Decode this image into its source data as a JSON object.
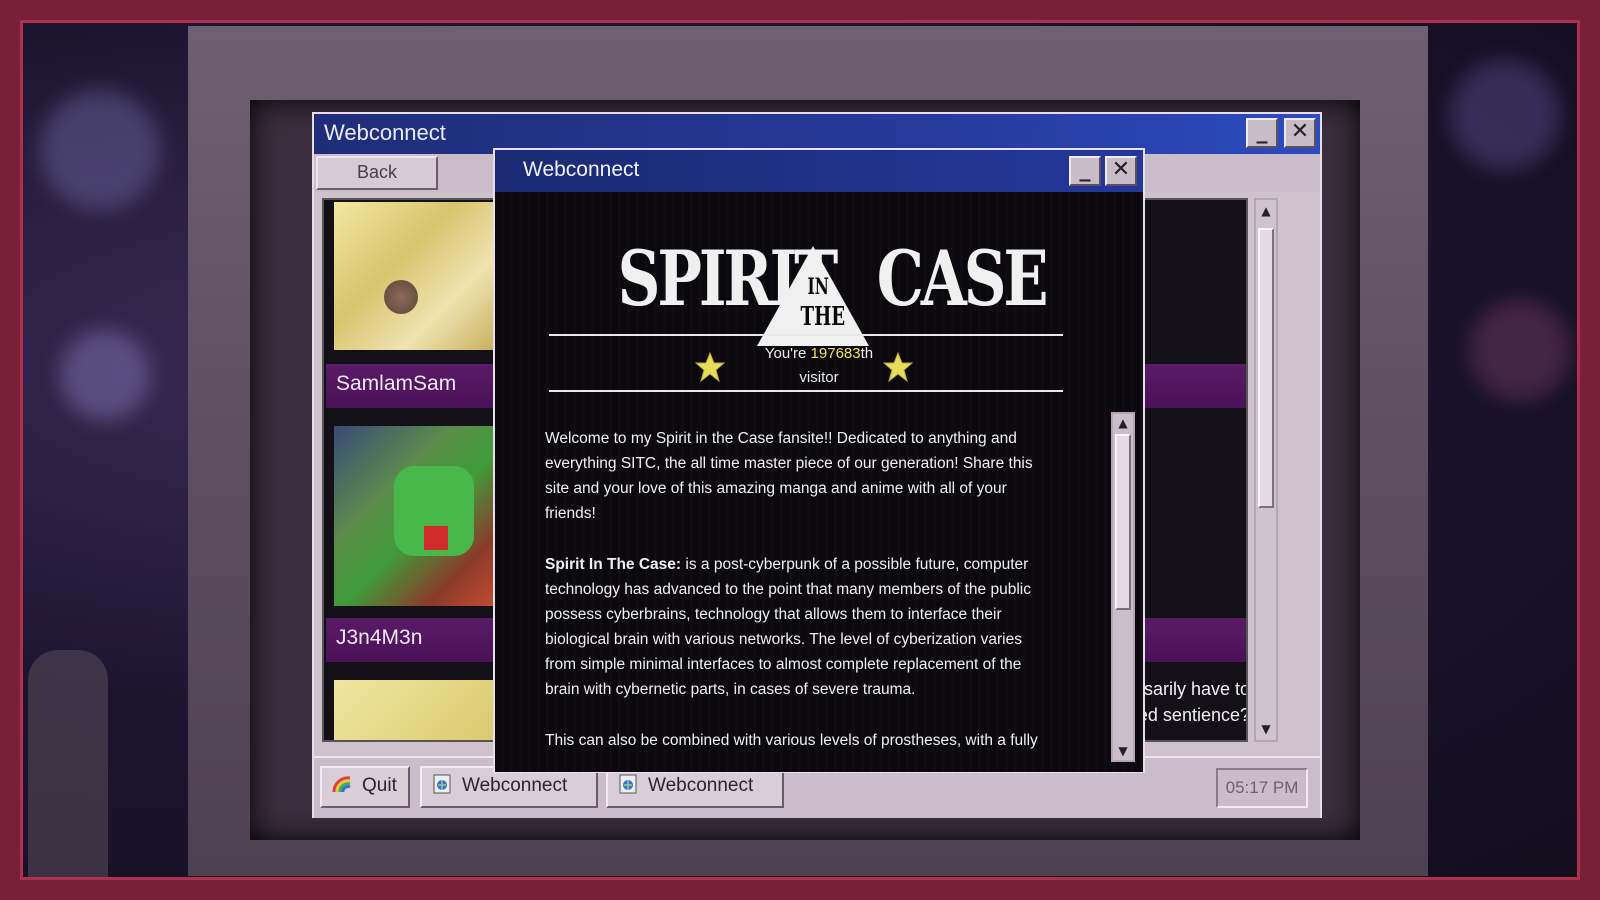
{
  "background_window": {
    "title": "Webconnect",
    "minimize_label": "_",
    "close_label": "✕",
    "back_label": "Back",
    "users": [
      {
        "name": "SamlamSam"
      },
      {
        "name": "J3n4M3n"
      }
    ],
    "snippet_line1": "ssarily have to",
    "snippet_line2": "ed sentience?"
  },
  "taskbar": {
    "quit_label": "Quit",
    "tasks": [
      {
        "label": "Webconnect",
        "icon": "globe-icon"
      },
      {
        "label": "Webconnect",
        "icon": "globe-icon"
      }
    ],
    "clock": "05:17 PM"
  },
  "popup": {
    "title": "Webconnect",
    "minimize_label": "_",
    "close_label": "✕",
    "logo_left": "SPIRIT",
    "logo_in": "IN",
    "logo_the": "THE",
    "logo_right": "CASE",
    "counter_prefix": "You're ",
    "counter_number": "197683",
    "counter_suffix": "th",
    "counter_line2": "visitor",
    "paragraph1": "Welcome to my Spirit in the Case fansite!! Dedicated to anything and everything SITC, the all time master piece of our generation! Share this site and your love of this amazing manga and anime with all of your friends!",
    "paragraph2_bold": "Spirit In The Case:",
    "paragraph2": " is a post-cyberpunk of a possible future, computer technology has advanced to the point that many members of the public possess cyberbrains, technology that allows them to interface their biological brain with various networks. The level of cyberization varies from simple minimal interfaces to almost complete replacement of the brain with cybernetic parts, in cases of severe trauma.",
    "paragraph3": "This can also be combined with various levels of prostheses, with a fully"
  },
  "colors": {
    "titlebar": "#24389a",
    "accent_purple": "#4a1258",
    "counter_number": "#f2e35b",
    "frame": "#7a1f38"
  }
}
